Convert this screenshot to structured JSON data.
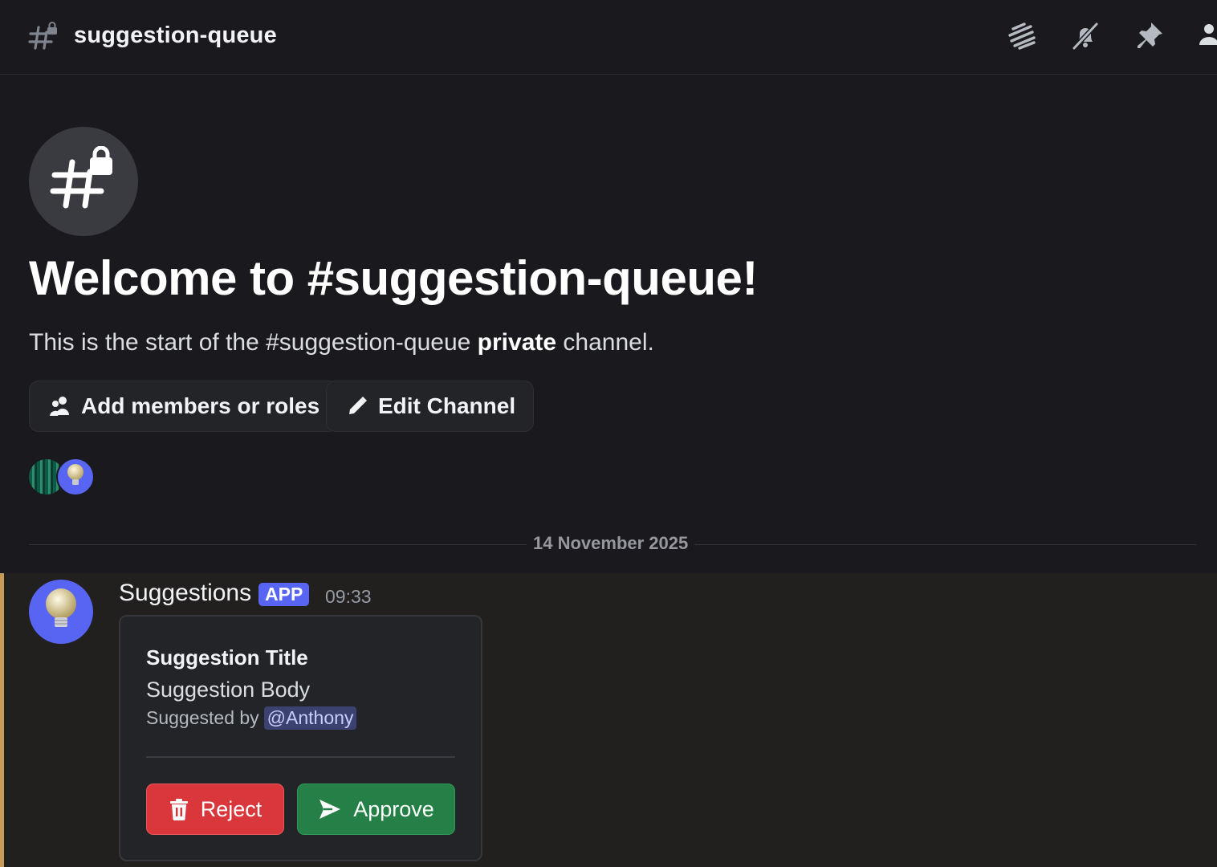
{
  "header": {
    "channel_name": "suggestion-queue",
    "actions": [
      {
        "name": "threads-icon"
      },
      {
        "name": "mute-bell-icon"
      },
      {
        "name": "pin-icon"
      },
      {
        "name": "members-icon"
      }
    ]
  },
  "intro": {
    "title": "Welcome to #suggestion-queue!",
    "subtitle_prefix": "This is the start of the #suggestion-queue ",
    "subtitle_bold": "private",
    "subtitle_suffix": " channel.",
    "add_members_label": "Add members or roles",
    "edit_channel_label": "Edit Channel"
  },
  "divider": {
    "date": "14 November 2025"
  },
  "message": {
    "author": "Suggestions",
    "badge": "APP",
    "time": "09:33",
    "accent_color": "#c69b57",
    "embed": {
      "title": "Suggestion Title",
      "body": "Suggestion Body",
      "footer_prefix": "Suggested by",
      "mention": "@Anthony",
      "reject_label": "Reject",
      "approve_label": "Approve"
    }
  },
  "colors": {
    "background": "#1a1a1e",
    "message_highlight": "#221f1f",
    "brand": "#5865f2",
    "danger": "#da373c",
    "success": "#248046"
  }
}
